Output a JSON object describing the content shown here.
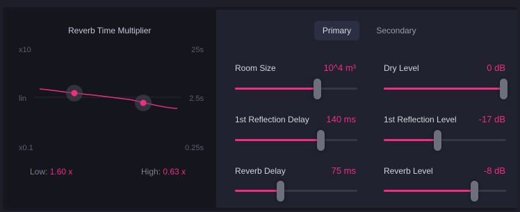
{
  "multiplier": {
    "title": "Reverb Time Multiplier",
    "left_top": "x10",
    "left_mid": "lin",
    "left_bottom": "x0.1",
    "right_top": "25s",
    "right_mid": "2.5s",
    "right_bottom": "0.25s",
    "low_label": "Low:",
    "low_value": "1.60 x",
    "high_label": "High:",
    "high_value": "0.63 x"
  },
  "tabs": {
    "primary": "Primary",
    "secondary": "Secondary",
    "active": "Primary"
  },
  "params": [
    {
      "label": "Room Size",
      "value": "10^4 m³",
      "position": 0.67
    },
    {
      "label": "Dry Level",
      "value": "0 dB",
      "position": 1.0
    },
    {
      "label": "1st Reflection Delay",
      "value": "140 ms",
      "position": 0.7
    },
    {
      "label": "1st Reflection Level",
      "value": "-17 dB",
      "position": 0.44
    },
    {
      "label": "Reverb Delay",
      "value": "75 ms",
      "position": 0.37
    },
    {
      "label": "Reverb Level",
      "value": "-8 dB",
      "position": 0.74
    }
  ],
  "colors": {
    "accent": "#ef2e83",
    "background": "#1d1e27"
  }
}
